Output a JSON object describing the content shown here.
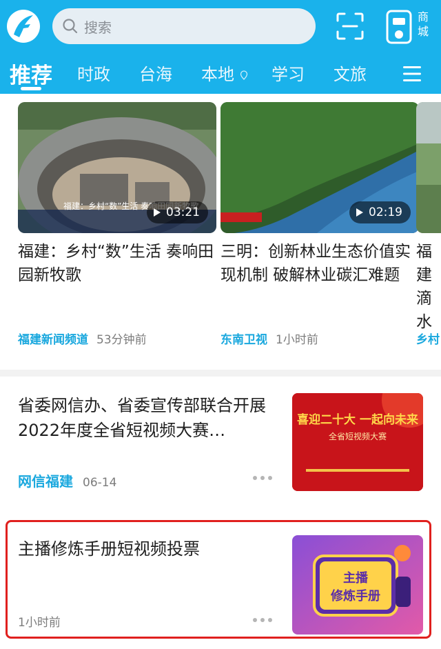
{
  "header": {
    "search_placeholder": "搜索",
    "mall_label_line1": "商",
    "mall_label_line2": "城",
    "colors": {
      "bar": "#1ab2eb",
      "accent": "#1aa8de",
      "highlight": "#e0201e"
    }
  },
  "tabs": [
    {
      "label": "推荐",
      "active": true
    },
    {
      "label": "时政"
    },
    {
      "label": "台海"
    },
    {
      "label": "本地"
    },
    {
      "label": "学习"
    },
    {
      "label": "文旅"
    }
  ],
  "videos": [
    {
      "title": "福建：乡村“数”生活 奏响田园新牧歌",
      "duration": "03:21",
      "source": "福建新闻频道",
      "time": "53分钟前",
      "caption": "福建：乡村“数”生活 奏响田园新牧歌"
    },
    {
      "title": "三明：创新林业生态价值实现机制 破解林业碳汇难题",
      "duration": "02:19",
      "source": "东南卫视",
      "time": "1小时前"
    },
    {
      "title": "福建滴水",
      "source": "乡村"
    }
  ],
  "news": [
    {
      "title": "省委网信办、省委宣传部联合开展2022年度全省短视频大赛…",
      "source": "网信福建",
      "time": "06-14",
      "thumb_line1": "喜迎二十大 一起向未来",
      "thumb_line2": "全省短视频大赛"
    },
    {
      "title": "主播修炼手册短视频投票",
      "time": "1小时前",
      "thumb_line1": "主播",
      "thumb_line2": "修炼手册"
    }
  ]
}
